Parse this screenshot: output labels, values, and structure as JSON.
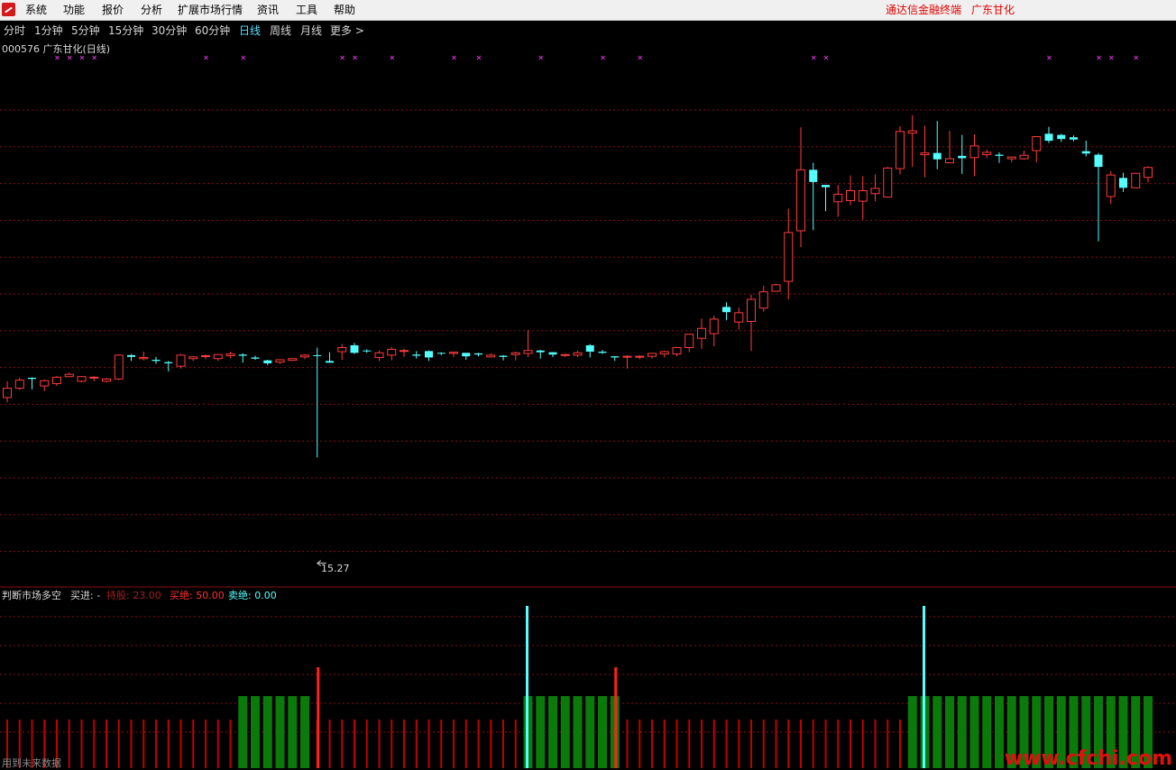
{
  "menu": {
    "items": [
      "系统",
      "功能",
      "报价",
      "分析",
      "扩展市场行情",
      "资讯",
      "工具",
      "帮助"
    ],
    "brand_left": "通达信金融终端",
    "brand_right": "广东甘化"
  },
  "periods": {
    "items": [
      "分时",
      "1分钟",
      "5分钟",
      "15分钟",
      "30分钟",
      "60分钟",
      "日线",
      "周线",
      "月线",
      "更多 >"
    ],
    "active": "日线"
  },
  "main_panel": {
    "title": "000576 广东甘化(日线)",
    "low_marker": "15.27"
  },
  "indicator": {
    "name": "判断市场多空",
    "buy_label": "买进: -",
    "hold_label": "持股: 23.00",
    "buy_all_label": "买绝: 50.00",
    "sell_all_label": "卖绝: 0.00"
  },
  "status_note": "用到未来数据",
  "watermark": "www.cfchi.com",
  "colors": {
    "up": "#ff3c3c",
    "down": "#54ffff",
    "grid": "#8a1010",
    "marker": "#cc33cc",
    "hold_bar": "#0a7a0a",
    "base_bar": "#c00000",
    "signal_up": "#ff2020",
    "signal_down": "#54ffff"
  },
  "chart_data": {
    "type": "candlestick",
    "ylim": [
      15,
      24
    ],
    "low_point": 15.27,
    "candles": [
      [
        18.12,
        18.28,
        18.04,
        18.4
      ],
      [
        18.28,
        18.42,
        18.25,
        18.46
      ],
      [
        18.46,
        18.44,
        18.26,
        18.47
      ],
      [
        18.32,
        18.41,
        18.23,
        18.43
      ],
      [
        18.36,
        18.47,
        18.32,
        18.49
      ],
      [
        18.48,
        18.52,
        18.48,
        18.55
      ],
      [
        18.4,
        18.48,
        18.38,
        18.49
      ],
      [
        18.47,
        18.47,
        18.4,
        18.49
      ],
      [
        18.4,
        18.44,
        18.38,
        18.46
      ],
      [
        18.44,
        18.85,
        18.42,
        18.86
      ],
      [
        18.85,
        18.82,
        18.75,
        18.87
      ],
      [
        18.79,
        18.81,
        18.76,
        18.91
      ],
      [
        18.77,
        18.75,
        18.7,
        18.82
      ],
      [
        18.73,
        18.71,
        18.57,
        18.75
      ],
      [
        18.66,
        18.85,
        18.62,
        18.87
      ],
      [
        18.79,
        18.82,
        18.75,
        18.83
      ],
      [
        18.84,
        18.84,
        18.78,
        18.86
      ],
      [
        18.79,
        18.86,
        18.75,
        18.86
      ],
      [
        18.84,
        18.87,
        18.8,
        18.91
      ],
      [
        18.86,
        18.84,
        18.72,
        18.88
      ],
      [
        18.81,
        18.79,
        18.77,
        18.84
      ],
      [
        18.76,
        18.71,
        18.68,
        18.77
      ],
      [
        18.73,
        18.77,
        18.7,
        18.78
      ],
      [
        18.76,
        18.79,
        18.75,
        18.79
      ],
      [
        18.82,
        18.85,
        18.78,
        18.87
      ],
      [
        18.85,
        18.84,
        17.09,
        18.98
      ],
      [
        18.75,
        18.72,
        18.88,
        18.9
      ],
      [
        18.91,
        18.98,
        18.77,
        19.04
      ],
      [
        19.02,
        18.89,
        18.87,
        19.06
      ],
      [
        18.93,
        18.92,
        18.89,
        18.95
      ],
      [
        18.81,
        18.89,
        18.75,
        18.93
      ],
      [
        18.85,
        18.95,
        18.76,
        18.99
      ],
      [
        18.93,
        18.93,
        18.82,
        18.96
      ],
      [
        18.86,
        18.84,
        18.79,
        18.92
      ],
      [
        18.92,
        18.81,
        18.75,
        18.93
      ],
      [
        18.89,
        18.88,
        18.85,
        18.9
      ],
      [
        18.88,
        18.9,
        18.82,
        18.91
      ],
      [
        18.89,
        18.83,
        18.77,
        18.86
      ],
      [
        18.88,
        18.86,
        18.83,
        18.89
      ],
      [
        18.82,
        18.85,
        18.81,
        18.88
      ],
      [
        18.84,
        18.82,
        18.76,
        18.85
      ],
      [
        18.86,
        18.89,
        18.76,
        18.91
      ],
      [
        18.88,
        18.93,
        18.82,
        19.28
      ],
      [
        18.93,
        18.9,
        18.79,
        18.94
      ],
      [
        18.9,
        18.86,
        18.82,
        18.9
      ],
      [
        18.86,
        18.86,
        18.82,
        18.87
      ],
      [
        18.85,
        18.89,
        18.82,
        18.93
      ],
      [
        19.02,
        18.91,
        18.81,
        19.04
      ],
      [
        18.91,
        18.89,
        18.87,
        18.94
      ],
      [
        18.83,
        18.81,
        18.75,
        18.83
      ],
      [
        18.83,
        18.83,
        18.62,
        18.85
      ],
      [
        18.83,
        18.83,
        18.78,
        18.85
      ],
      [
        18.83,
        18.88,
        18.79,
        18.89
      ],
      [
        18.87,
        18.91,
        18.81,
        18.93
      ],
      [
        18.87,
        18.98,
        18.83,
        18.99
      ],
      [
        18.98,
        19.21,
        18.9,
        19.22
      ],
      [
        19.14,
        19.31,
        18.96,
        19.48
      ],
      [
        19.22,
        19.47,
        19.0,
        19.53
      ],
      [
        19.68,
        19.59,
        19.45,
        19.76
      ],
      [
        19.42,
        19.58,
        19.29,
        19.67
      ],
      [
        19.43,
        19.81,
        18.92,
        19.89
      ],
      [
        19.66,
        19.94,
        19.6,
        20.04
      ],
      [
        19.95,
        20.06,
        19.98,
        20.08
      ],
      [
        20.12,
        20.96,
        19.81,
        21.37
      ],
      [
        20.99,
        22.04,
        20.71,
        22.77
      ],
      [
        22.04,
        21.83,
        21.0,
        22.16
      ],
      [
        21.78,
        21.74,
        21.33,
        21.77
      ],
      [
        21.49,
        21.62,
        21.23,
        21.78
      ],
      [
        21.51,
        21.68,
        21.43,
        21.94
      ],
      [
        21.5,
        21.68,
        21.18,
        21.93
      ],
      [
        21.63,
        21.72,
        21.5,
        21.96
      ],
      [
        21.57,
        22.07,
        21.56,
        22.09
      ],
      [
        22.06,
        22.7,
        21.96,
        22.79
      ],
      [
        22.67,
        22.71,
        22.09,
        22.98
      ],
      [
        22.3,
        22.33,
        21.91,
        22.8
      ],
      [
        22.33,
        22.22,
        22.05,
        22.88
      ],
      [
        22.16,
        22.23,
        22.31,
        22.71
      ],
      [
        22.28,
        22.24,
        21.97,
        22.64
      ],
      [
        22.25,
        22.45,
        21.93,
        22.65
      ],
      [
        22.3,
        22.34,
        22.24,
        22.39
      ],
      [
        22.3,
        22.28,
        22.16,
        22.34
      ],
      [
        22.23,
        22.26,
        22.17,
        22.26
      ],
      [
        22.23,
        22.29,
        22.21,
        22.37
      ],
      [
        22.37,
        22.61,
        22.17,
        22.62
      ],
      [
        22.66,
        22.54,
        22.5,
        22.78
      ],
      [
        22.64,
        22.57,
        22.52,
        22.66
      ],
      [
        22.6,
        22.56,
        22.53,
        22.63
      ],
      [
        22.36,
        22.32,
        22.27,
        22.54
      ],
      [
        22.3,
        22.09,
        20.81,
        22.33
      ],
      [
        21.58,
        21.95,
        21.45,
        22.02
      ],
      [
        21.9,
        21.73,
        21.66,
        21.99
      ],
      [
        21.73,
        21.98,
        21.72,
        21.98
      ],
      [
        21.91,
        22.08,
        21.82,
        22.1
      ]
    ],
    "candle_fields": [
      "open",
      "close",
      "low",
      "high"
    ]
  }
}
